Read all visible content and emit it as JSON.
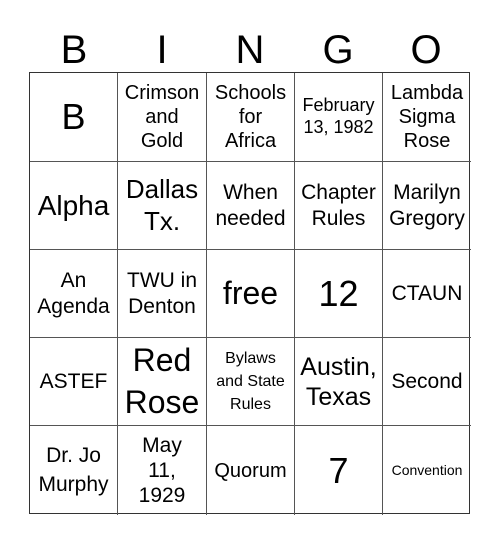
{
  "header": [
    "B",
    "I",
    "N",
    "G",
    "O"
  ],
  "cells": [
    "B",
    "Crimson\nand\nGold",
    "Schools\nfor\nAfrica",
    "February\n13, 1982",
    "Lambda\nSigma\nRose",
    "Alpha",
    "Dallas\nTx.",
    "When\nneeded",
    "Chapter\nRules",
    "Marilyn\nGregory",
    "An\nAgenda",
    "TWU in\nDenton",
    "free",
    "12",
    "CTAUN",
    "ASTEF",
    "Red\nRose",
    "Bylaws\nand State\nRules",
    "Austin,\nTexas",
    "Second",
    "Dr. Jo\nMurphy",
    "May\n11,\n1929",
    "Quorum",
    "7",
    "Convention"
  ]
}
